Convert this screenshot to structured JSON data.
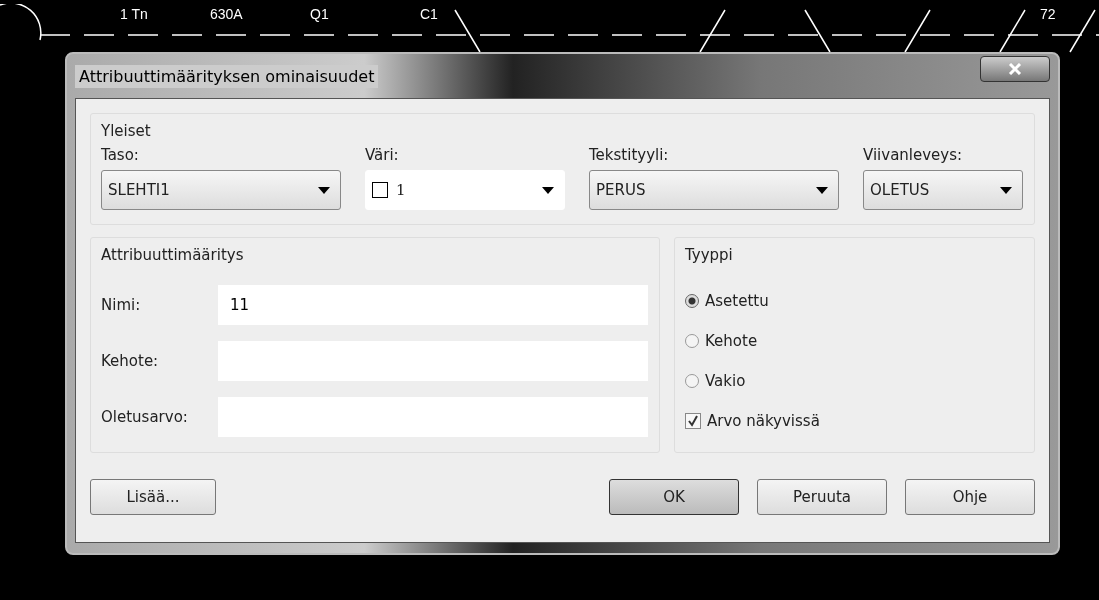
{
  "canvas": {
    "labels": [
      {
        "text": "1 Tn"
      },
      {
        "text": "630A"
      },
      {
        "text": "Q1"
      },
      {
        "text": "C1"
      },
      {
        "text": "72"
      }
    ]
  },
  "window": {
    "title": "Attribuuttimäärityksen ominaisuudet"
  },
  "general": {
    "title": "Yleiset",
    "fields": [
      {
        "label": "Taso:",
        "value": "SLEHTI1",
        "kind": "plain"
      },
      {
        "label": "Väri:",
        "value": "1",
        "kind": "color"
      },
      {
        "label": "Tekstityyli:",
        "value": "PERUS",
        "kind": "plain"
      },
      {
        "label": "Viivanleveys:",
        "value": "OLETUS",
        "kind": "plain"
      }
    ]
  },
  "attribute": {
    "title": "Attribuuttimääritys",
    "fields": [
      {
        "label": "Nimi:",
        "value": "11"
      },
      {
        "label": "Kehote:"
      },
      {
        "label": "Oletusarvo:"
      }
    ]
  },
  "type": {
    "title": "Tyyppi",
    "options": [
      {
        "label": "Asetettu",
        "selected": true
      },
      {
        "label": "Kehote",
        "selected": false
      },
      {
        "label": "Vakio",
        "selected": false
      }
    ],
    "visible": {
      "label": "Arvo näkyvissä",
      "checked": true
    }
  },
  "buttons": {
    "more": "Lisää...",
    "actions": [
      "OK",
      "Peruuta",
      "Ohje"
    ]
  }
}
